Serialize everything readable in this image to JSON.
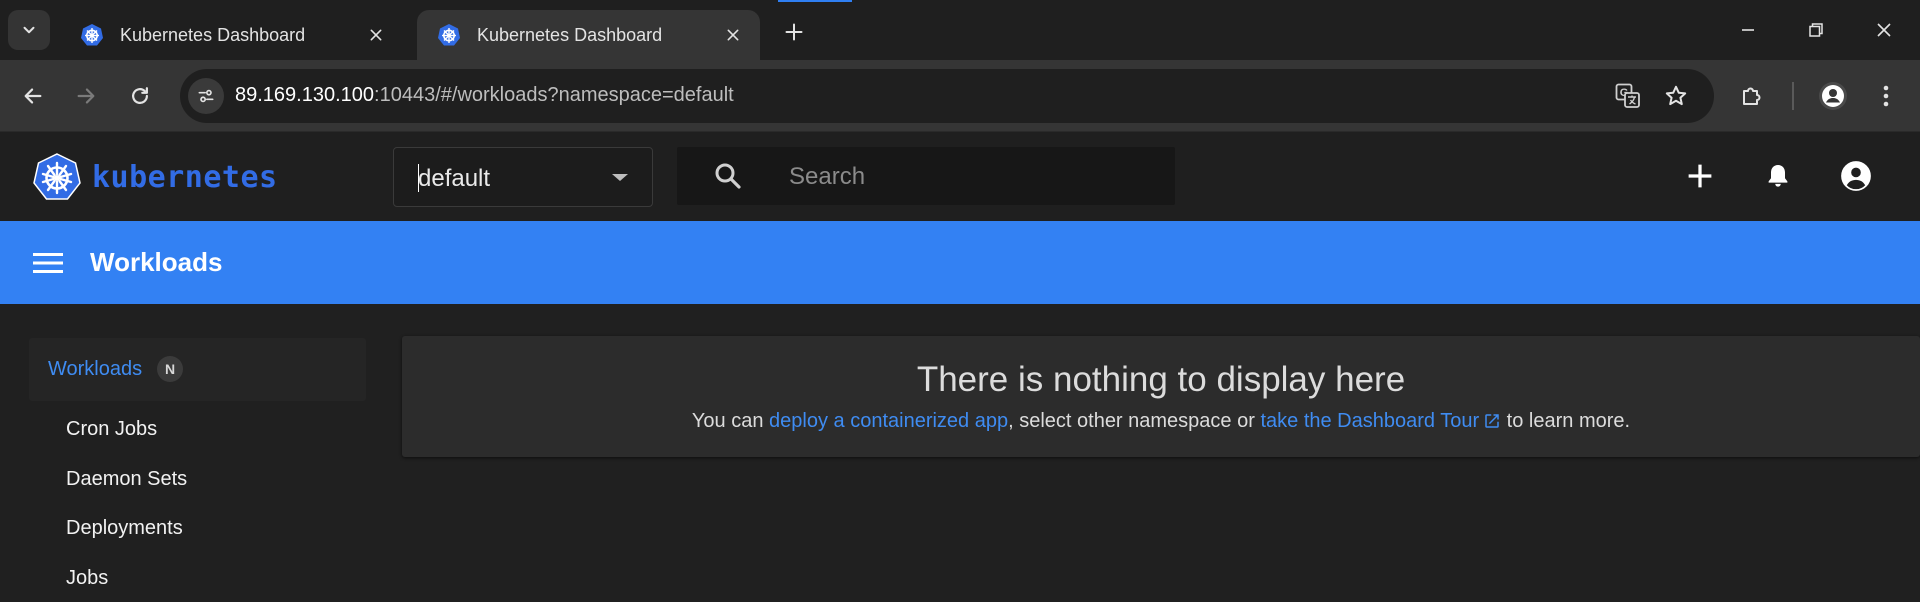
{
  "browser": {
    "tabs": [
      {
        "title": "Kubernetes Dashboard",
        "active": false
      },
      {
        "title": "Kubernetes Dashboard",
        "active": true
      }
    ],
    "address": {
      "host": "89.169.130.100",
      "rest": ":10443/#/workloads?namespace=default"
    },
    "icons": {
      "tab_search": "chevron-down-icon",
      "new_tab": "plus-icon",
      "minimize": "minimize-icon",
      "restore": "restore-icon",
      "close": "close-icon",
      "back": "arrow-left-icon",
      "forward": "arrow-right-icon",
      "reload": "reload-icon",
      "site_info": "tune-icon",
      "translate": "translate-icon",
      "bookmark": "star-icon",
      "extensions": "puzzle-icon",
      "profile": "person-icon",
      "menu": "kebab-icon"
    }
  },
  "header": {
    "brand": "kubernetes",
    "namespace": "default",
    "search_placeholder": "Search",
    "icons": {
      "create": "plus-icon",
      "notifications": "bell-icon",
      "account": "account-circle-icon"
    }
  },
  "titlebar": {
    "title": "Workloads",
    "menu_icon": "hamburger-icon"
  },
  "sidebar": {
    "group": {
      "label": "Workloads",
      "badge": "N"
    },
    "items": [
      "Cron Jobs",
      "Daemon Sets",
      "Deployments",
      "Jobs"
    ]
  },
  "empty_state": {
    "title": "There is nothing to display here",
    "prefix": "You can ",
    "link1": "deploy a containerized app",
    "middle": ", select other namespace or ",
    "link2": "take the Dashboard Tour",
    "suffix": " to learn more."
  },
  "colors": {
    "accent": "#3381f3",
    "link": "#3f8cf2",
    "brand": "#326ce5",
    "background": "#202020"
  }
}
